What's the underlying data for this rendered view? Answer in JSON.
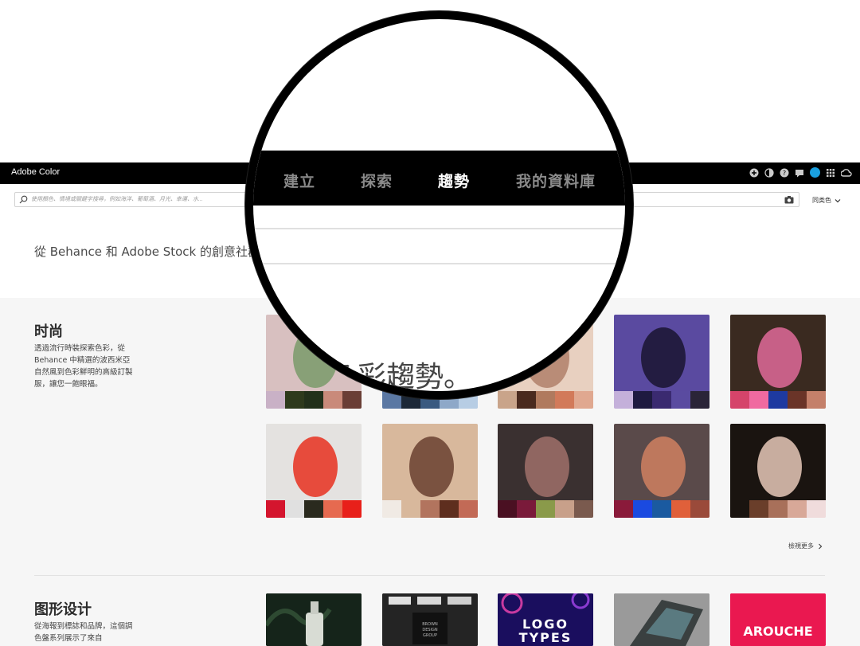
{
  "app": {
    "title": "Adobe Color"
  },
  "lens": {
    "nav": [
      {
        "label": "建立",
        "active": false
      },
      {
        "label": "探索",
        "active": false
      },
      {
        "label": "趨勢",
        "active": true
      },
      {
        "label": "我的資料庫",
        "active": false
      }
    ],
    "heading_fragment": "色彩趨勢。"
  },
  "search": {
    "placeholder": "使用顏色、情境或關鍵字搜尋，例如海洋、葡萄酒、月光、幸運、水..."
  },
  "sort": {
    "label": "同类色"
  },
  "hero": {
    "text": "從 Behance 和 Adobe Stock 的創意社群，"
  },
  "sections": [
    {
      "title": "时尚",
      "description": "透過流行時裝探索色彩，從 Behance 中精選的波西米亞自然風到色彩鮮明的高級訂製服，讓您一飽眼福。",
      "cards": [
        {
          "image": "fashion-flowers-photo",
          "swatches": [
            "#c9b1c6",
            "#2e3a1c",
            "#22301a",
            "#c98a7a",
            "#6a3e36"
          ]
        },
        {
          "image": "fashion-blue-photo",
          "swatches": [
            "#5b78a3",
            "#1c2838",
            "#3a5a80",
            "#8ea8c8",
            "#b7cde4"
          ]
        },
        {
          "image": "fashion-skin-photo",
          "swatches": [
            "#c9a48a",
            "#4a2a1e",
            "#b07a5e",
            "#d27a5a",
            "#e0a890"
          ]
        },
        {
          "image": "fashion-purple-photo",
          "swatches": [
            "#c4b0da",
            "#1e1a40",
            "#3a2a70",
            "#5a4ba0",
            "#2a2438"
          ]
        },
        {
          "image": "fashion-makeup-photo",
          "swatches": [
            "#d5446a",
            "#f06aa0",
            "#1e3aa0",
            "#6a3428",
            "#c4806a"
          ]
        }
      ],
      "cards_row2": [
        {
          "image": "fashion-red-dress-photo",
          "swatches": [
            "#d4152e",
            "#e0e0e0",
            "#2a2a1e",
            "#e66a50",
            "#e8201a"
          ]
        },
        {
          "image": "fashion-three-models-photo",
          "swatches": [
            "#f0eae4",
            "#d8b89c",
            "#b2745e",
            "#5e2e1e",
            "#c26a56"
          ]
        },
        {
          "image": "fashion-man-flowers-photo",
          "swatches": [
            "#4a1022",
            "#7a1a3a",
            "#8a9a4a",
            "#c8a08a",
            "#7a5a4e"
          ]
        },
        {
          "image": "fashion-colorful-photo",
          "swatches": [
            "#8a1a3a",
            "#1a4ae0",
            "#1a5aa0",
            "#e0603a",
            "#9a4a3a"
          ]
        },
        {
          "image": "fashion-sweater-photo",
          "swatches": [
            "#1a1410",
            "#6a3e2a",
            "#a8705a",
            "#d8a898",
            "#f0dcdc"
          ]
        }
      ]
    },
    {
      "title": "图形设计",
      "description": "從海報到標誌和品牌，這個調色盤系列展示了來自",
      "cards": [
        {
          "image": "graphic-bottle-photo"
        },
        {
          "image": "graphic-brown-design-photo",
          "text": "BROWN DESIGN GROUP"
        },
        {
          "image": "graphic-logo-types-photo",
          "text": "LOGO TYPES"
        },
        {
          "image": "graphic-book-photo"
        },
        {
          "image": "graphic-arouche-photo",
          "text": "AROUCHE"
        }
      ]
    }
  ],
  "view_more": {
    "label": "檢視更多"
  },
  "colors": {
    "topbar": "#000000",
    "accent_avatar": "#1aa0e0",
    "gallery_bg": "#f6f6f6"
  },
  "icons": [
    "plus-icon",
    "contrast-icon",
    "help-icon",
    "chat-icon",
    "avatar",
    "apps-icon",
    "creative-cloud-icon",
    "search-icon",
    "camera-icon",
    "chevron-down-icon",
    "chevron-right-icon"
  ]
}
